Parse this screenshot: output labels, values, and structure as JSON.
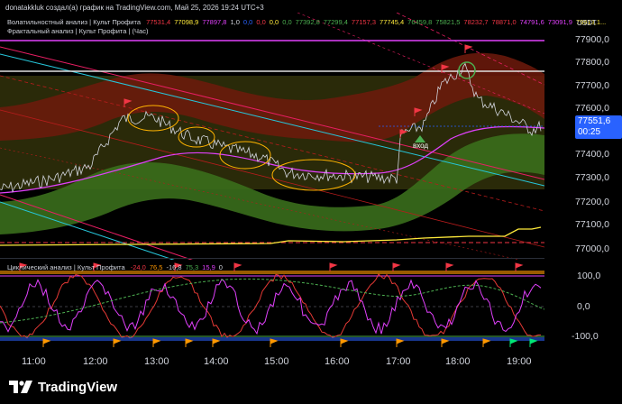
{
  "header": {
    "title": "donatakkluk создал(а) график на TradingView.com, Май 25, 2026 19:24 UTC+3",
    "currency": "USDT"
  },
  "indicators": {
    "volatility": {
      "label": "Волатильностный анализ | Культ Профита",
      "values": [
        "77531,4",
        "77098,9",
        "77897,8",
        "1,0",
        "0,0",
        "0,0",
        "0,0",
        "0,0",
        "77392,8",
        "77299,4",
        "77157,3",
        "77745,4",
        "76459,8",
        "75821,5",
        "78232,7",
        "78871,0",
        "74791,6",
        "73091,9",
        "79513,1..."
      ],
      "colors": [
        "#f23645",
        "#ffeb3b",
        "#e040fb",
        "#d1d4dc",
        "#2962ff",
        "#f23645",
        "#ffeb3b",
        "#4caf50",
        "#4caf50",
        "#4caf50",
        "#f23645",
        "#ffeb3b",
        "#4caf50",
        "#4caf50",
        "#f23645",
        "#f23645",
        "#e040fb",
        "#e040fb",
        "#ffeb3b"
      ]
    },
    "fractal": {
      "label": "Фрактальный анализ | Культ Профита | (Час)"
    },
    "cyclic": {
      "label": "Циклический анализ | Культ Профита",
      "values": [
        "-24,0",
        "76,5",
        "-16,8",
        "75,3",
        "15,9",
        "0"
      ],
      "colors": [
        "#f23645",
        "#ff9800",
        "#d1d4dc",
        "#4caf50",
        "#e040fb",
        "#d1d4dc"
      ]
    }
  },
  "price_axis": {
    "labels": [
      "77900,0",
      "77800,0",
      "77700,0",
      "77600,0",
      "77400,0",
      "77300,0",
      "77200,0",
      "77100,0",
      "77000,0"
    ],
    "current_price": "77551,6",
    "countdown": "00:25"
  },
  "osc_axis": {
    "labels": [
      "100,0",
      "0,0",
      "-100,0"
    ]
  },
  "time_axis": {
    "labels": [
      "11:00",
      "12:00",
      "13:00",
      "14:00",
      "15:00",
      "16:00",
      "17:00",
      "18:00",
      "19:00"
    ]
  },
  "annotations": {
    "entry": "вход"
  },
  "colors": {
    "background": "#000000",
    "price_label": "#2962ff",
    "band_red": "#8b1a0a",
    "band_green": "#3d7a1c",
    "pink_line": "#e91e63",
    "cyan_line": "#26c6da"
  },
  "footer": {
    "brand": "TradingView"
  }
}
